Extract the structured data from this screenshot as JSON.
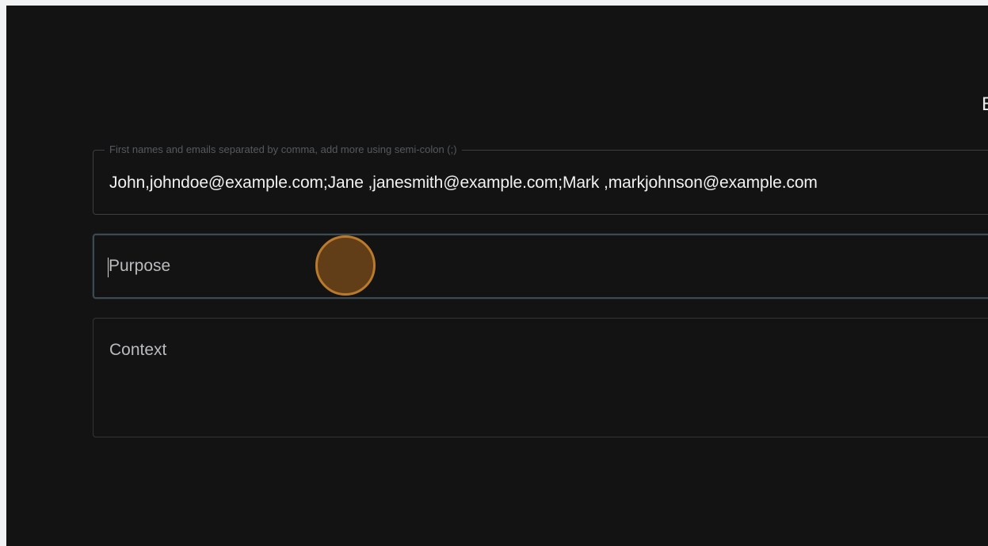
{
  "header": {
    "title_fragment": "E"
  },
  "form": {
    "recipients": {
      "label": "First names and emails separated by comma, add more using semi-colon (;)",
      "value": "John,johndoe@example.com;Jane ,janesmith@example.com;Mark ,markjohnson@example.com"
    },
    "purpose": {
      "placeholder": "Purpose",
      "value": ""
    },
    "context": {
      "placeholder": "Context",
      "value": ""
    }
  },
  "colors": {
    "background": "#131314",
    "field_border": "#3a3d40",
    "focused_border": "#3c4a52",
    "click_marker": "#b97a2d"
  }
}
